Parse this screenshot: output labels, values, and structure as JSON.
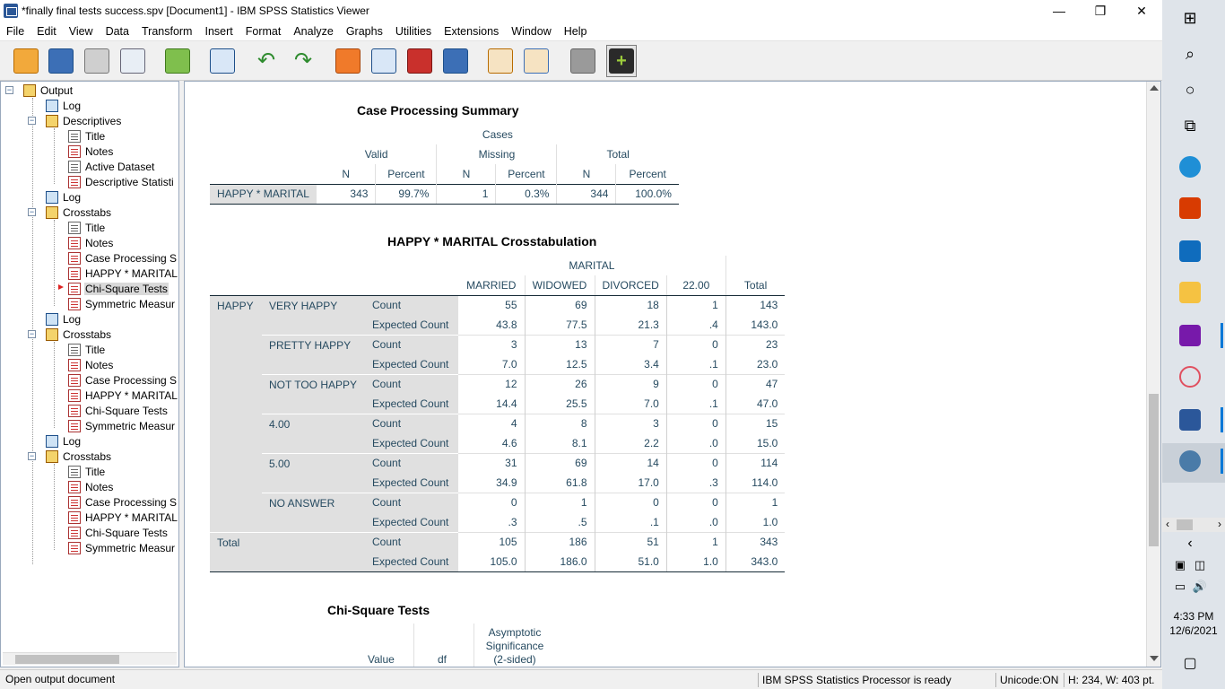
{
  "window": {
    "title": "*finally final tests success.spv [Document1] - IBM SPSS Statistics Viewer",
    "minimize": "—",
    "maximize": "❐",
    "close": "✕"
  },
  "menu": [
    {
      "label": "File"
    },
    {
      "label": "Edit"
    },
    {
      "label": "View"
    },
    {
      "label": "Data"
    },
    {
      "label": "Transform"
    },
    {
      "label": "Insert"
    },
    {
      "label": "Format"
    },
    {
      "label": "Analyze"
    },
    {
      "label": "Graphs"
    },
    {
      "label": "Utilities"
    },
    {
      "label": "Extensions"
    },
    {
      "label": "Window"
    },
    {
      "label": "Help"
    }
  ],
  "toolbar": {
    "icons": [
      "open-icon",
      "save-icon",
      "print-icon",
      "print-preview-icon",
      "export-icon",
      "recall-dialog-icon",
      "undo-icon",
      "redo-icon",
      "goto-case-icon",
      "goto-variable-icon",
      "insert-cases-icon",
      "variables-icon",
      "designated-window-icon",
      "run-script-icon",
      "show-hide-icon",
      "add-icon"
    ]
  },
  "tree": {
    "nodes": [
      {
        "label": "Output",
        "icon": "folder"
      },
      {
        "label": "Log",
        "icon": "book"
      },
      {
        "label": "Descriptives",
        "icon": "folder"
      },
      {
        "label": "Title",
        "icon": "doc"
      },
      {
        "label": "Notes",
        "icon": "table"
      },
      {
        "label": "Active Dataset",
        "icon": "doc"
      },
      {
        "label": "Descriptive Statisti",
        "icon": "table"
      },
      {
        "label": "Log",
        "icon": "book"
      },
      {
        "label": "Crosstabs",
        "icon": "folder"
      },
      {
        "label": "Title",
        "icon": "doc"
      },
      {
        "label": "Notes",
        "icon": "table"
      },
      {
        "label": "Case Processing S",
        "icon": "table"
      },
      {
        "label": "HAPPY * MARITAL",
        "icon": "table"
      },
      {
        "label": "Chi-Square Tests",
        "icon": "table"
      },
      {
        "label": "Symmetric Measur",
        "icon": "table"
      },
      {
        "label": "Log",
        "icon": "book"
      },
      {
        "label": "Crosstabs",
        "icon": "folder"
      },
      {
        "label": "Title",
        "icon": "doc"
      },
      {
        "label": "Notes",
        "icon": "table"
      },
      {
        "label": "Case Processing S",
        "icon": "table"
      },
      {
        "label": "HAPPY * MARITAL",
        "icon": "table"
      },
      {
        "label": "Chi-Square Tests",
        "icon": "table"
      },
      {
        "label": "Symmetric Measur",
        "icon": "table"
      },
      {
        "label": "Log",
        "icon": "book"
      },
      {
        "label": "Crosstabs",
        "icon": "folder"
      },
      {
        "label": "Title",
        "icon": "doc"
      },
      {
        "label": "Notes",
        "icon": "table"
      },
      {
        "label": "Case Processing S",
        "icon": "table"
      },
      {
        "label": "HAPPY * MARITAL",
        "icon": "table"
      },
      {
        "label": "Chi-Square Tests",
        "icon": "table"
      },
      {
        "label": "Symmetric Measur",
        "icon": "table"
      }
    ]
  },
  "case_summary": {
    "title": "Case Processing Summary",
    "cases": "Cases",
    "valid": "Valid",
    "missing": "Missing",
    "total": "Total",
    "n": "N",
    "percent": "Percent",
    "row_label": "HAPPY * MARITAL",
    "values": [
      "343",
      "99.7%",
      "1",
      "0.3%",
      "344",
      "100.0%"
    ]
  },
  "crosstab": {
    "title": "HAPPY * MARITAL Crosstabulation",
    "col_var": "MARITAL",
    "columns": [
      "MARRIED",
      "WIDOWED",
      "DIVORCED",
      "22.00",
      "Total"
    ],
    "row_var": "HAPPY",
    "count_label": "Count",
    "expected_label": "Expected Count",
    "total_label": "Total",
    "groups": [
      {
        "label": "VERY HAPPY",
        "count": [
          "55",
          "69",
          "18",
          "1",
          "143"
        ],
        "expected": [
          "43.8",
          "77.5",
          "21.3",
          ".4",
          "143.0"
        ]
      },
      {
        "label": "PRETTY HAPPY",
        "count": [
          "3",
          "13",
          "7",
          "0",
          "23"
        ],
        "expected": [
          "7.0",
          "12.5",
          "3.4",
          ".1",
          "23.0"
        ]
      },
      {
        "label": "NOT TOO HAPPY",
        "count": [
          "12",
          "26",
          "9",
          "0",
          "47"
        ],
        "expected": [
          "14.4",
          "25.5",
          "7.0",
          ".1",
          "47.0"
        ]
      },
      {
        "label": "4.00",
        "count": [
          "4",
          "8",
          "3",
          "0",
          "15"
        ],
        "expected": [
          "4.6",
          "8.1",
          "2.2",
          ".0",
          "15.0"
        ]
      },
      {
        "label": "5.00",
        "count": [
          "31",
          "69",
          "14",
          "0",
          "114"
        ],
        "expected": [
          "34.9",
          "61.8",
          "17.0",
          ".3",
          "114.0"
        ]
      },
      {
        "label": "NO ANSWER",
        "count": [
          "0",
          "1",
          "0",
          "0",
          "1"
        ],
        "expected": [
          ".3",
          ".5",
          ".1",
          ".0",
          "1.0"
        ]
      }
    ],
    "total_row": {
      "count": [
        "105",
        "186",
        "51",
        "1",
        "343"
      ],
      "expected": [
        "105.0",
        "186.0",
        "51.0",
        "1.0",
        "343.0"
      ]
    }
  },
  "chi_square": {
    "title": "Chi-Square Tests",
    "value": "Value",
    "df": "df",
    "asym_1": "Asymptotic",
    "asym_2": "Significance",
    "asym_3": "(2-sided)"
  },
  "status": {
    "left": "Open output document",
    "processor": "IBM SPSS Statistics Processor is ready",
    "unicode": "Unicode:ON",
    "dims": "H: 234, W: 403 pt."
  },
  "taskbar": {
    "time": "4:33 PM",
    "date": "12/6/2021"
  }
}
